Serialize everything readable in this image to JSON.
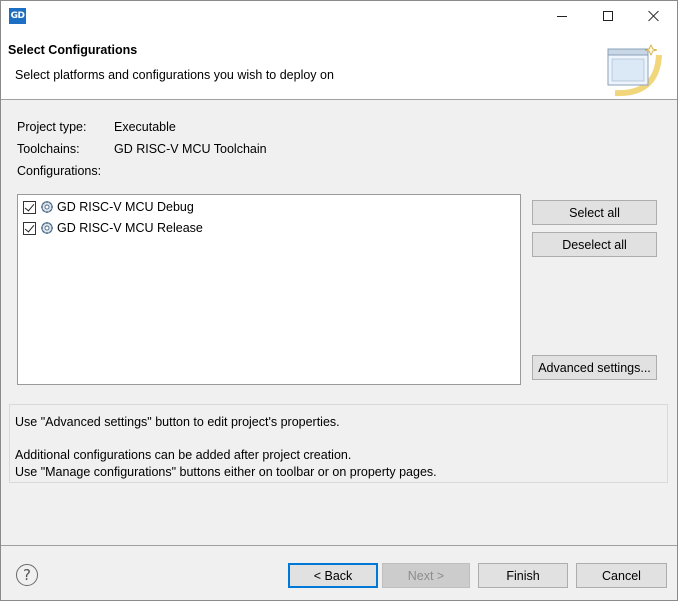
{
  "window": {
    "app_icon_text": "GD"
  },
  "header": {
    "title": "Select Configurations",
    "description": "Select platforms and configurations you wish to deploy on"
  },
  "project": {
    "type_label": "Project type:",
    "type_value": "Executable",
    "toolchains_label": "Toolchains:",
    "toolchains_value": "GD RISC-V MCU Toolchain",
    "configurations_label": "Configurations:"
  },
  "configurations": [
    {
      "label": "GD RISC-V MCU Debug",
      "checked": true
    },
    {
      "label": "GD RISC-V MCU Release",
      "checked": true
    }
  ],
  "side_buttons": {
    "select_all": "Select all",
    "deselect_all": "Deselect all",
    "advanced": "Advanced settings..."
  },
  "notes": {
    "line1": "Use \"Advanced settings\" button to edit project's properties.",
    "line2": "Additional configurations can be added after project creation.",
    "line3": "Use \"Manage configurations\" buttons either on toolbar or on property pages."
  },
  "footer": {
    "help_glyph": "?",
    "back": "< Back",
    "next": "Next >",
    "finish": "Finish",
    "cancel": "Cancel"
  }
}
